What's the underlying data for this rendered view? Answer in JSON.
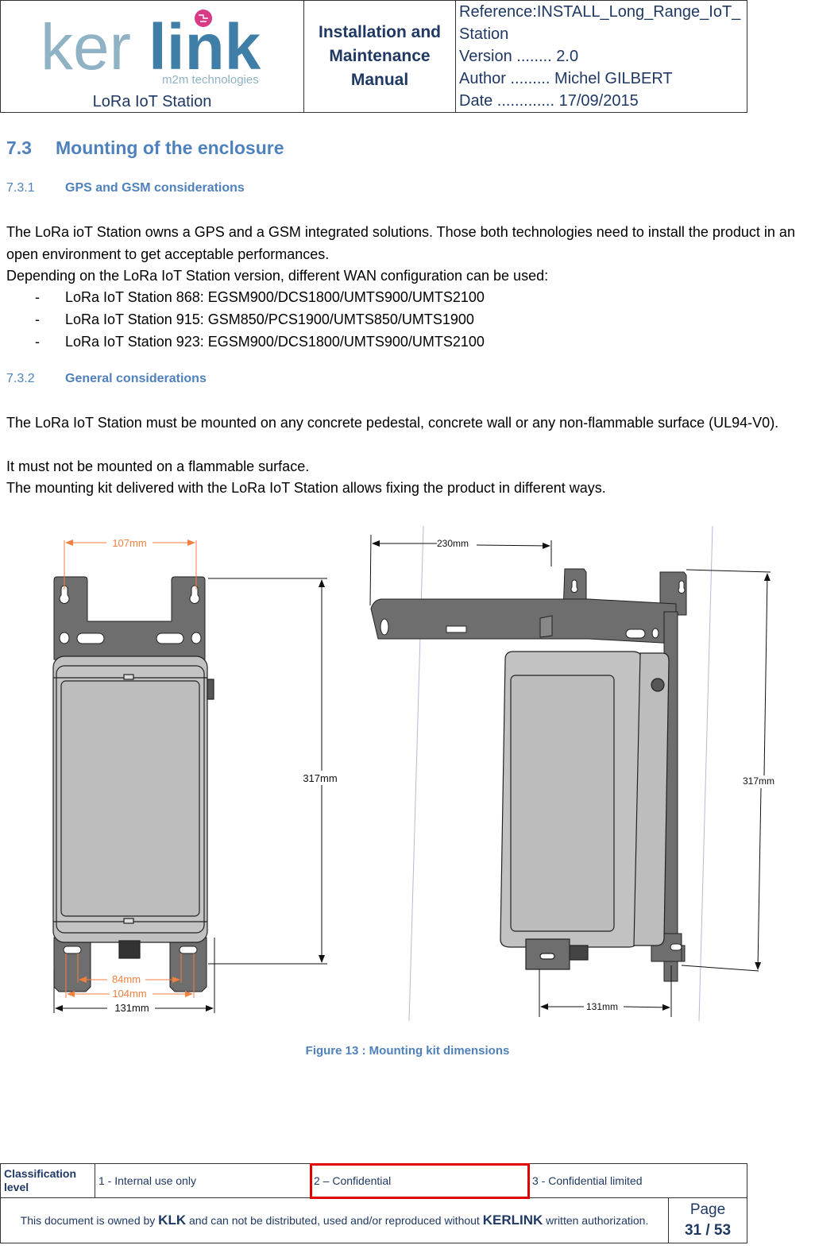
{
  "header": {
    "logo": {
      "brand_left": "ker",
      "brand_right": "link",
      "tagline": "m2m technologies",
      "colors": {
        "brand_left": "#8fb2c5",
        "brand_right": "#3f7ea7",
        "accent": "#d93a86"
      }
    },
    "product": "LoRa IoT Station",
    "doc_title_lines": [
      "Installation and",
      "Maintenance",
      "Manual"
    ],
    "meta": {
      "reference_line1": "Reference:INSTALL_Long_Range_IoT_",
      "reference_line2": "Station",
      "version": "Version ........ 2.0",
      "author": "Author ......... Michel GILBERT",
      "date": "Date ............. 17/09/2015"
    }
  },
  "section": {
    "number": "7.3",
    "title": "Mounting of the enclosure",
    "subsections": [
      {
        "number": "7.3.1",
        "title": "GPS and GSM considerations",
        "paragraphs": [
          "The LoRa ioT Station owns a GPS and a GSM integrated solutions. Those both technologies need to install the product in an open environment to get acceptable performances.",
          "Depending on the LoRa IoT Station version, different WAN configuration can be used:"
        ],
        "bullets": [
          "LoRa IoT Station 868: EGSM900/DCS1800/UMTS900/UMTS2100",
          "LoRa IoT Station 915: GSM850/PCS1900/UMTS850/UMTS1900",
          "LoRa IoT Station 923: EGSM900/DCS1800/UMTS900/UMTS2100"
        ]
      },
      {
        "number": "7.3.2",
        "title": "General considerations",
        "paragraphs": [
          "The LoRa IoT Station must be mounted on any concrete pedestal, concrete wall or any non-flammable surface (UL94-V0).",
          "It must not be mounted on a flammable surface.",
          "The mounting kit delivered with the LoRa IoT Station allows fixing the product in different ways."
        ]
      }
    ]
  },
  "figure": {
    "front_view": {
      "dim_hole_spacing_top": "107mm",
      "dim_height": "317mm",
      "dim_slot_inner": "84mm",
      "dim_slot_outer": "104mm",
      "dim_width": "131mm"
    },
    "side_view": {
      "dim_arm_length": "230mm",
      "dim_height": "317mm",
      "dim_depth": "131mm"
    },
    "colors": {
      "dimension_accent": "#f08040",
      "bracket": "#6e6e6e",
      "enclosure": "#c0c0c0"
    },
    "caption": "Figure 13 : Mounting kit dimensions"
  },
  "footer": {
    "classification_label": "Classification level",
    "levels": [
      "1 - Internal use only",
      "2 – Confidential",
      "3 - Confidential limited"
    ],
    "selected_level": 2,
    "ownership": {
      "prefix": "This document is owned by ",
      "owner_short": "KLK",
      "middle": " and can not be distributed, used and/or reproduced  without ",
      "owner_full": "KERLINK",
      "suffix": "  written authorization."
    },
    "page_label": "Page",
    "page_number": "31 / 53"
  }
}
